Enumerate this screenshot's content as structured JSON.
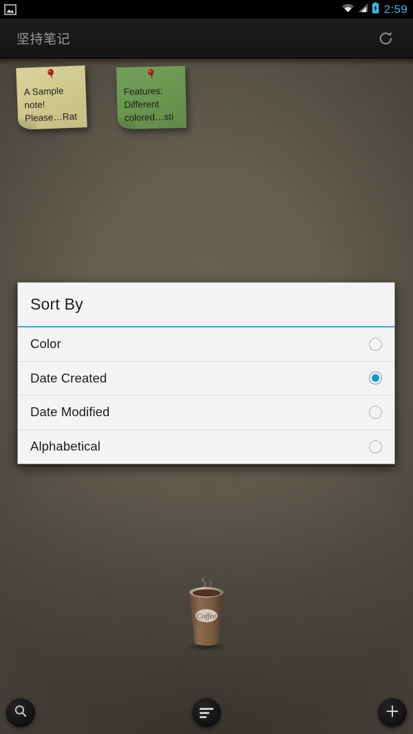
{
  "status_bar": {
    "notification_icon": "screenshot-image-icon",
    "icons": [
      "wifi-icon",
      "cellular-signal-icon",
      "battery-charging-icon"
    ],
    "clock": "2:59",
    "clock_color": "#35b5e5"
  },
  "action_bar": {
    "title": "坚持笔记",
    "refresh_icon": "refresh-icon"
  },
  "notes": [
    {
      "lines": [
        "A Sample",
        "note!",
        "Please…Rat"
      ],
      "color": "#cfc88c",
      "color_name": "yellow",
      "pin_icon": "push-pin-icon"
    },
    {
      "lines": [
        "Features:",
        "Different",
        "colored…sti"
      ],
      "color": "#69964f",
      "color_name": "green",
      "pin_icon": "push-pin-icon"
    }
  ],
  "wallpaper": {
    "background_color": "#5f584c",
    "artwork": "coffee-cup-illustration",
    "artwork_label": "Coffee"
  },
  "dialog": {
    "title": "Sort By",
    "accent_color": "#36a8e0",
    "selected_value": "Date Created",
    "options": [
      {
        "label": "Color",
        "selected": false
      },
      {
        "label": "Date Created",
        "selected": true
      },
      {
        "label": "Date Modified",
        "selected": false
      },
      {
        "label": "Alphabetical",
        "selected": false
      }
    ]
  },
  "fabs": [
    {
      "name": "search",
      "icon": "search-icon"
    },
    {
      "name": "sort",
      "icon": "sort-lines-icon"
    },
    {
      "name": "add",
      "icon": "plus-icon"
    }
  ]
}
